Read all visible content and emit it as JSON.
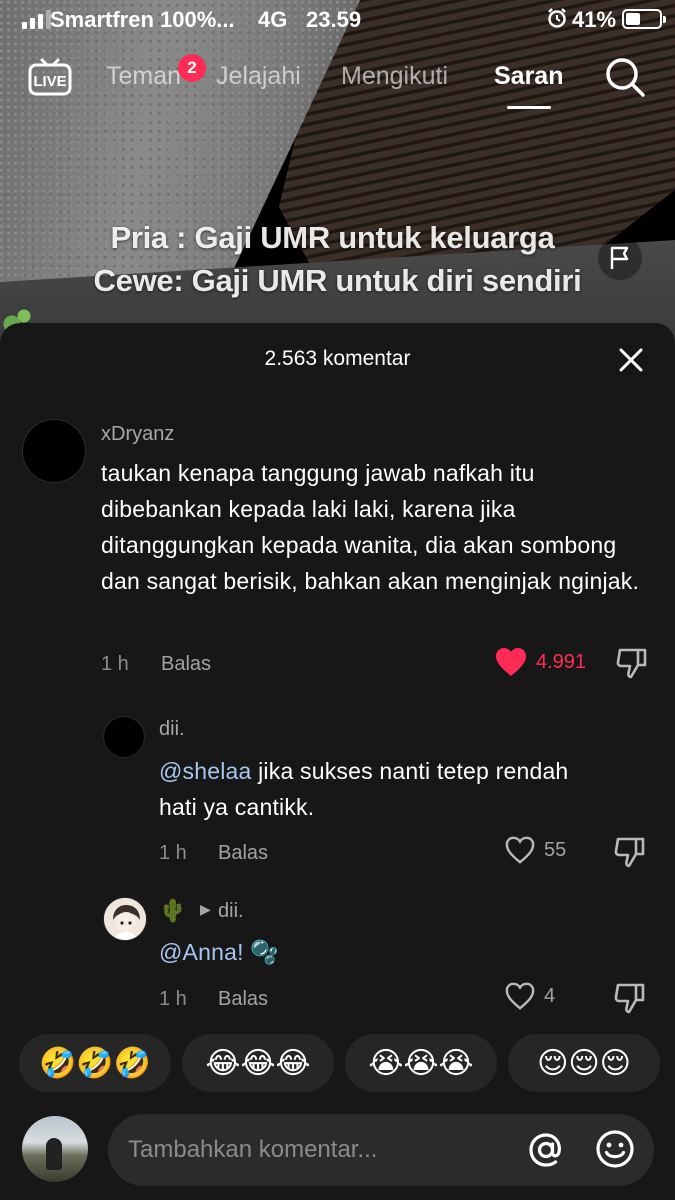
{
  "status_bar": {
    "carrier": "Smartfren 100%...",
    "network": "4G",
    "time": "23.59",
    "battery": "41%"
  },
  "top_nav": {
    "tabs": [
      {
        "label": "Teman"
      },
      {
        "label": "Jelajahi"
      },
      {
        "label": "Mengikuti"
      },
      {
        "label": "Saran"
      }
    ],
    "friends_badge": "2",
    "active_tab": "Saran"
  },
  "video": {
    "caption_line1": "Pria : Gaji UMR untuk keluarga",
    "caption_line2": "Cewe: Gaji UMR untuk diri sendiri"
  },
  "comments_sheet": {
    "title": "2.563 komentar",
    "comments": [
      {
        "username": "xDryanz",
        "text": "taukan kenapa tanggung jawab nafkah itu dibebankan kepada laki laki, karena jika ditanggungkan kepada wanita, dia akan sombong dan sangat berisik, bahkan akan menginjak nginjak.",
        "time": "1 h",
        "reply_label": "Balas",
        "likes": "4.991",
        "liked": true
      }
    ],
    "replies": [
      {
        "username": "dii.",
        "mention": "@shelaa",
        "text_line1": " jika sukses nanti tetep rendah",
        "text_line2": "hati ya cantikk.",
        "time": "1 h",
        "reply_label": "Balas",
        "likes": "55"
      },
      {
        "username": "🌵",
        "reply_to": "dii.",
        "mention": "@Anna!",
        "emoji": "🫧",
        "time": "1 h",
        "reply_label": "Balas",
        "likes": "4"
      }
    ]
  },
  "emoji_bar": [
    "🤣🤣🤣",
    "😂😂😂",
    "😭😭😭",
    "😌😌😌"
  ],
  "comment_input": {
    "placeholder": "Tambahkan komentar..."
  },
  "colors": {
    "sheet_bg": "#171717",
    "like_red": "#fe2c55",
    "mention_blue": "#a9c6ee"
  }
}
